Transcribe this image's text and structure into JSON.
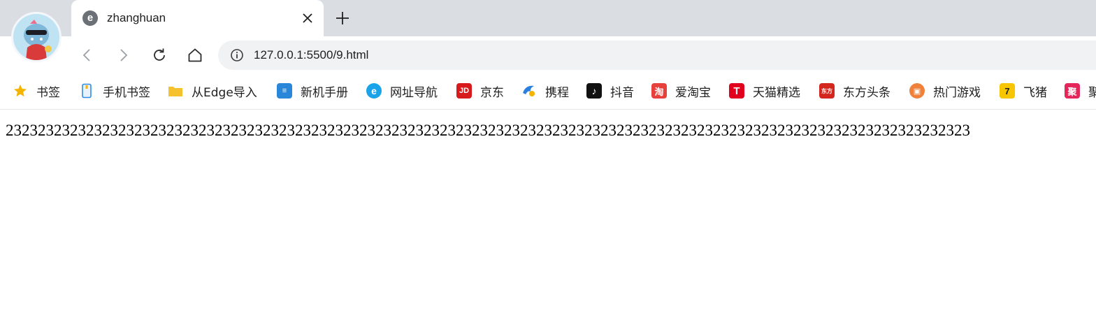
{
  "tab": {
    "title": "zhanghuan",
    "close_icon": "close-icon",
    "favicon": "edge-page-icon"
  },
  "toolbar": {
    "url": "127.0.0.1:5500/9.html",
    "back_icon": "back-arrow-icon",
    "forward_icon": "forward-arrow-icon",
    "reload_icon": "reload-icon",
    "home_icon": "home-icon",
    "site_info_icon": "info-icon"
  },
  "bookmarks": [
    {
      "label": "书签",
      "icon": "star-icon",
      "color": "#f5b400"
    },
    {
      "label": "手机书签",
      "icon": "phone-icon",
      "color": "#2e8ce6"
    },
    {
      "label": "从Edge导入",
      "icon": "folder-icon",
      "color": "#f5c12e"
    },
    {
      "label": "新机手册",
      "icon": "manual-icon",
      "color": "#2a86d8"
    },
    {
      "label": "网址导航",
      "icon": "edge-icon",
      "color": "#1aa3e8"
    },
    {
      "label": "京东",
      "icon": "jd-icon",
      "color": "#d71a1c"
    },
    {
      "label": "携程",
      "icon": "ctrip-icon",
      "color": "#2a7fe0"
    },
    {
      "label": "抖音",
      "icon": "douyin-icon",
      "color": "#111111"
    },
    {
      "label": "爱淘宝",
      "icon": "taobao-icon",
      "color": "#e8403a"
    },
    {
      "label": "天猫精选",
      "icon": "tmall-icon",
      "color": "#e1001d"
    },
    {
      "label": "东方头条",
      "icon": "eastday-icon",
      "color": "#d3261c"
    },
    {
      "label": "热门游戏",
      "icon": "game-icon",
      "color": "#f0813a"
    },
    {
      "label": "飞猪",
      "icon": "fliggy-icon",
      "color": "#f7c600"
    },
    {
      "label": "聚",
      "icon": "ju-icon",
      "color": "#e5265a"
    }
  ],
  "page": {
    "text": "232323232323232323232323232323232323232323232323232323232323232323232323232323232323232323232323232323232323232323232323"
  }
}
